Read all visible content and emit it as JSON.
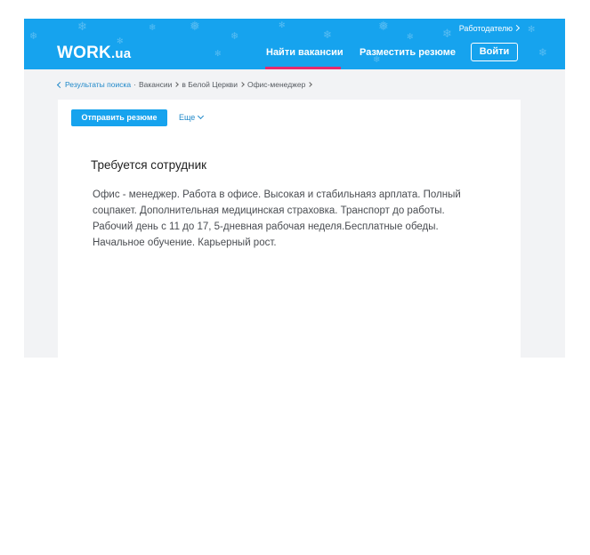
{
  "header": {
    "logo_main": "WORK",
    "logo_sub": ".ua",
    "employer_link": "Работодателю",
    "nav": {
      "find_jobs": "Найти вакансии",
      "post_resume": "Разместить резюме"
    },
    "login_label": "Войти",
    "colors": {
      "header_bg": "#16a3ee",
      "active_tab": "#e7296d"
    }
  },
  "breadcrumb": {
    "back": "Результаты поиска",
    "separator": "·",
    "items": [
      "Вакансии",
      "в Белой Церкви",
      "Офис-менеджер"
    ]
  },
  "actions": {
    "send_resume": "Отправить резюме",
    "more": "Еще"
  },
  "job": {
    "title": "Требуется сотрудник",
    "description": "Офис - менеджер. Работа в офисе. Высокая и стабильнаяз арплата. Полный соцпакет. Дополнительная медицинская страховка. Транспорт до работы. Рабочий день с 11 до 17, 5-дневная рабочая неделя.Бесплатные обеды. Начальное обучение. Карьерный рост."
  }
}
